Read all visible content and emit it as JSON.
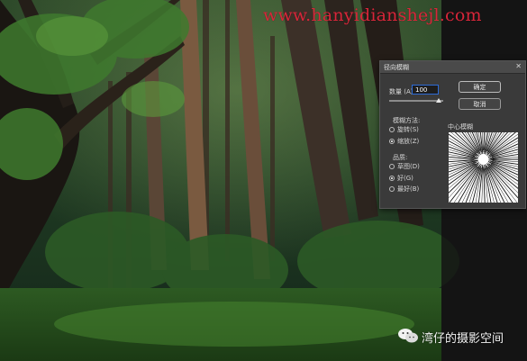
{
  "watermark": {
    "url": "www.hanyidianshejl.com"
  },
  "dialog": {
    "title": "径向模糊",
    "close_glyph": "✕",
    "amount_label": "数量 (A)",
    "amount_value": "100",
    "ok_label": "确定",
    "cancel_label": "取消",
    "blur_method_label": "模糊方法:",
    "blur_methods": [
      {
        "label": "旋转(S)",
        "selected": false
      },
      {
        "label": "缩放(Z)",
        "selected": true
      }
    ],
    "quality_label": "品质:",
    "quality_options": [
      {
        "label": "草图(D)",
        "selected": false
      },
      {
        "label": "好(G)",
        "selected": true
      },
      {
        "label": "最好(B)",
        "selected": false
      }
    ],
    "center_label": "中心模糊"
  },
  "footer": {
    "account_name": "湾仔的摄影空间"
  },
  "colors": {
    "accent_input_border": "#2d6bd6",
    "watermark_red": "#d8263a"
  }
}
